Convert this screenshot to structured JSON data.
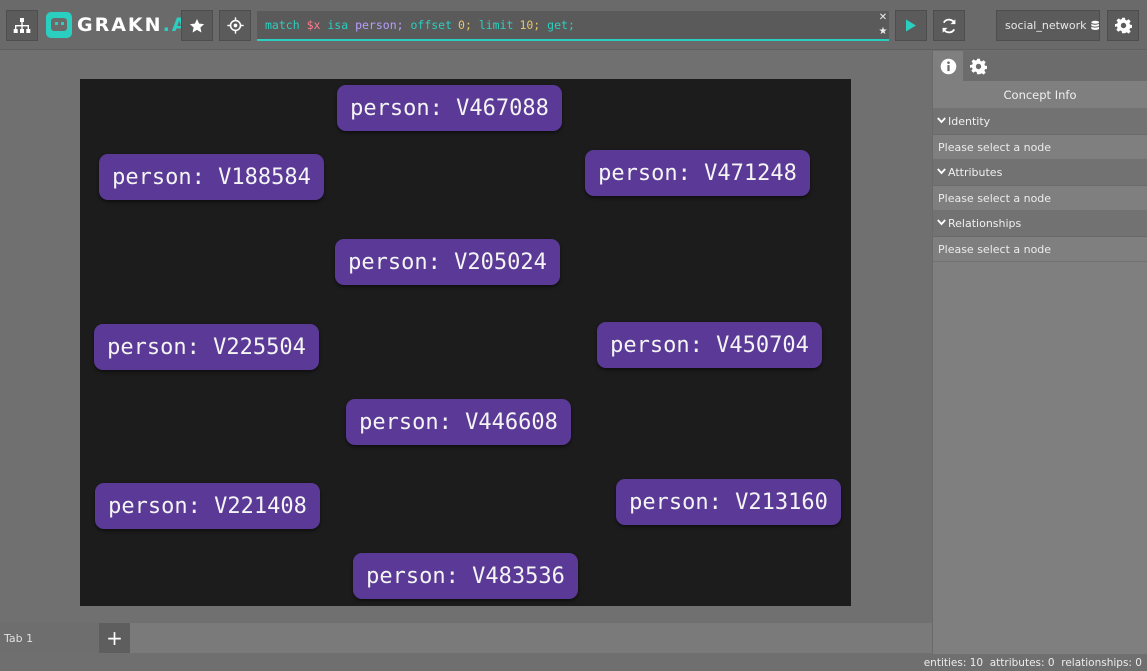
{
  "header": {
    "logo_main": "GRAKN",
    "logo_suffix": ".AI",
    "query": {
      "kw_match": "match",
      "var": "$x",
      "kw_isa": "isa",
      "type": "person;",
      "kw_offset": "offset",
      "offset_val": "0;",
      "kw_limit": "limit",
      "limit_val": "10;",
      "kw_get": "get;"
    },
    "clear_glyph": "✕",
    "star_glyph": "★",
    "keyspace": "social_network"
  },
  "nodes": [
    {
      "label": "person: V467088"
    },
    {
      "label": "person: V188584"
    },
    {
      "label": "person: V471248"
    },
    {
      "label": "person: V205024"
    },
    {
      "label": "person: V225504"
    },
    {
      "label": "person: V450704"
    },
    {
      "label": "person: V446608"
    },
    {
      "label": "person: V221408"
    },
    {
      "label": "person: V213160"
    },
    {
      "label": "person: V483536"
    }
  ],
  "tabs": {
    "items": [
      {
        "label": "Tab 1"
      }
    ],
    "add_label": "+"
  },
  "panel": {
    "title": "Concept Info",
    "sections": [
      {
        "heading": "Identity",
        "body": "Please select a node"
      },
      {
        "heading": "Attributes",
        "body": "Please select a node"
      },
      {
        "heading": "Relationships",
        "body": "Please select a node"
      }
    ]
  },
  "status": {
    "text": "entities: 10  attributes: 0  relationships: 0"
  },
  "colors": {
    "accent": "#2bcfc0",
    "node": "#5a3a96",
    "canvas": "#1c1c1c"
  }
}
